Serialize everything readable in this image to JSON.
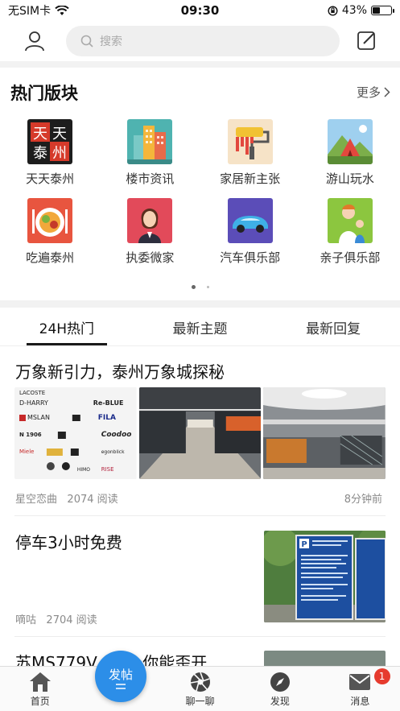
{
  "status": {
    "carrier": "无SIM卡",
    "time": "09:30",
    "battery": "43%",
    "battery_level": 0.43
  },
  "search": {
    "placeholder": "搜索"
  },
  "hot": {
    "title": "热门版块",
    "more": "更多",
    "items": [
      {
        "label": "天天泰州",
        "icon": "tiantian-taizhou-logo"
      },
      {
        "label": "楼市资讯",
        "icon": "buildings-icon"
      },
      {
        "label": "家居新主张",
        "icon": "paint-roller-icon"
      },
      {
        "label": "游山玩水",
        "icon": "tent-mountain-icon"
      },
      {
        "label": "吃遍泰州",
        "icon": "food-plate-icon"
      },
      {
        "label": "执委微家",
        "icon": "woman-avatar-icon"
      },
      {
        "label": "汽车俱乐部",
        "icon": "car-icon"
      },
      {
        "label": "亲子俱乐部",
        "icon": "parent-child-icon"
      }
    ]
  },
  "tabs": [
    "24H热门",
    "最新主题",
    "最新回复"
  ],
  "posts": [
    {
      "title": "万象新引力，泰州万象城探秘",
      "author": "星空恋曲",
      "reads": "2074 阅读",
      "time": "8分钟前"
    },
    {
      "title": "停车3小时免费",
      "author": "嘀咕",
      "reads": "2704 阅读"
    },
    {
      "title": "苏MS779V...主，你能歪开"
    }
  ],
  "brand_wall": [
    "LACOSTE",
    "D-HARRY",
    "Re-BLUE",
    "MSLAN",
    "FILA",
    "N 1906",
    "Coodoo",
    "Miele",
    "egonblick",
    "HIMO",
    "RISE"
  ],
  "parking_sign": {
    "letter": "P"
  },
  "tabbar": {
    "home": "首页",
    "post": "发帖",
    "chat": "聊一聊",
    "discover": "发现",
    "messages": "消息",
    "message_badge": "1"
  },
  "colors": {
    "accent": "#2c8ee8",
    "badge": "#e63b2e"
  }
}
